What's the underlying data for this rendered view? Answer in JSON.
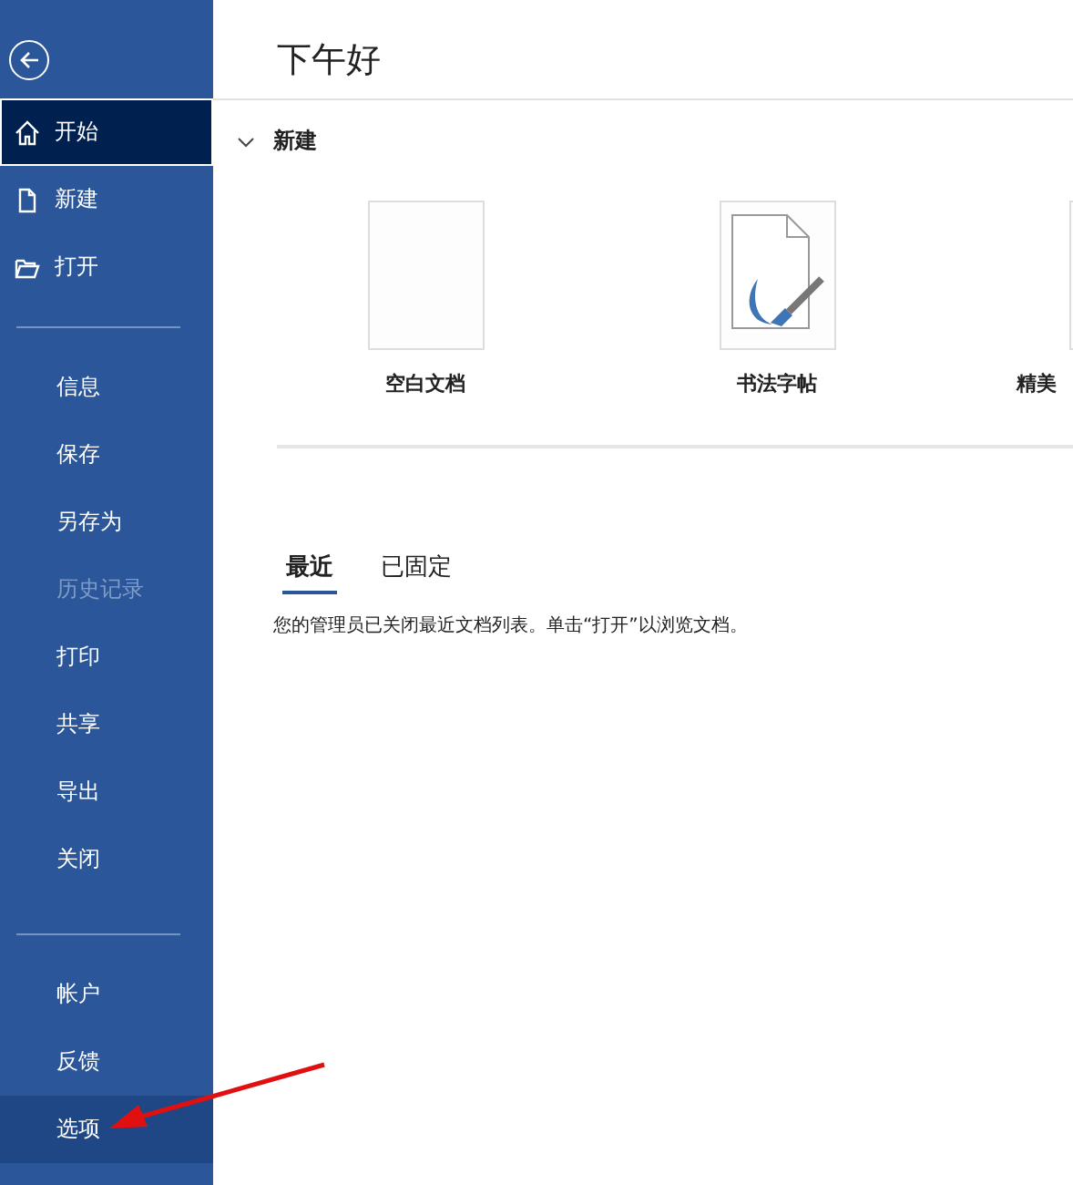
{
  "sidebar": {
    "top_items": [
      {
        "label": "开始",
        "kind": "home",
        "selected": true
      },
      {
        "label": "新建",
        "kind": "file",
        "selected": false
      },
      {
        "label": "打开",
        "kind": "folder",
        "selected": false
      }
    ],
    "middle_items": [
      {
        "label": "信息",
        "disabled": false
      },
      {
        "label": "保存",
        "disabled": false
      },
      {
        "label": "另存为",
        "disabled": false
      },
      {
        "label": "历史记录",
        "disabled": true
      },
      {
        "label": "打印",
        "disabled": false
      },
      {
        "label": "共享",
        "disabled": false
      },
      {
        "label": "导出",
        "disabled": false
      },
      {
        "label": "关闭",
        "disabled": false
      }
    ],
    "bottom_items": [
      {
        "label": "帐户",
        "hovered": false
      },
      {
        "label": "反馈",
        "hovered": false
      },
      {
        "label": "选项",
        "hovered": true
      }
    ]
  },
  "greeting": "下午好",
  "new_section": {
    "title": "新建",
    "expanded": true,
    "templates": [
      {
        "label": "空白文档",
        "kind": "blank"
      },
      {
        "label": "书法字帖",
        "kind": "calligraphy"
      },
      {
        "label": "精美",
        "kind": "partial"
      }
    ]
  },
  "tabs": [
    {
      "label": "最近",
      "selected": true
    },
    {
      "label": "已固定",
      "selected": false
    }
  ],
  "message": "您的管理员已关闭最近文档列表。单击“打开”以浏览文档。"
}
